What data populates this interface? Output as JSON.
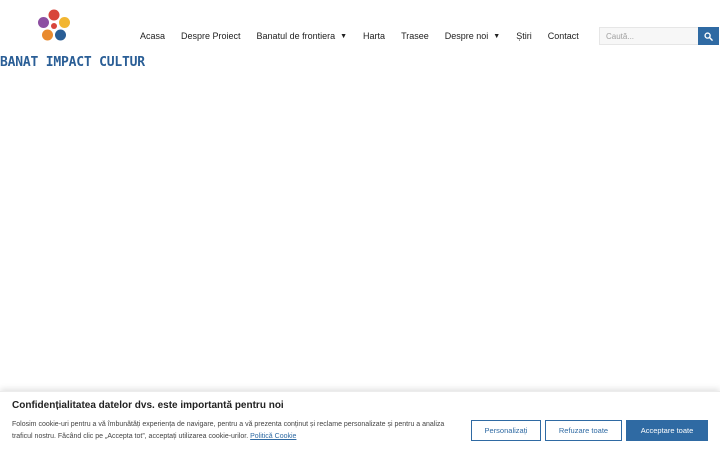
{
  "header": {
    "logo_text": "BANAT IMPACT CULTUR",
    "nav": [
      {
        "label": "Acasa"
      },
      {
        "label": "Despre Proiect"
      },
      {
        "label": "Banatul de frontiera"
      },
      {
        "label": "Harta"
      },
      {
        "label": "Trasee"
      },
      {
        "label": "Despre noi"
      },
      {
        "label": "Știri"
      },
      {
        "label": "Contact"
      }
    ],
    "search": {
      "placeholder": "Caută..."
    }
  },
  "cookie_banner": {
    "title": "Confidențialitatea datelor dvs. este importantă pentru noi",
    "text": "Folosim cookie-uri pentru a vă îmbunătăți experiența de navigare, pentru a vă prezenta conținut și reclame personalizate și pentru a analiza traficul nostru. Făcând clic pe „Accepta tot”, acceptați utilizarea cookie-urilor.",
    "policy_link": "Politică Cookie",
    "buttons": {
      "customize": "Personalizați",
      "reject": "Refuzare toate",
      "accept": "Acceptare toate"
    }
  },
  "colors": {
    "accent": "#2f6aa3",
    "logo_blue": "#2a5e96",
    "logo_red": "#d8453b",
    "logo_yellow": "#f2b632"
  },
  "icons": {
    "search": "search-icon",
    "dropdown": "caret-down-icon"
  }
}
